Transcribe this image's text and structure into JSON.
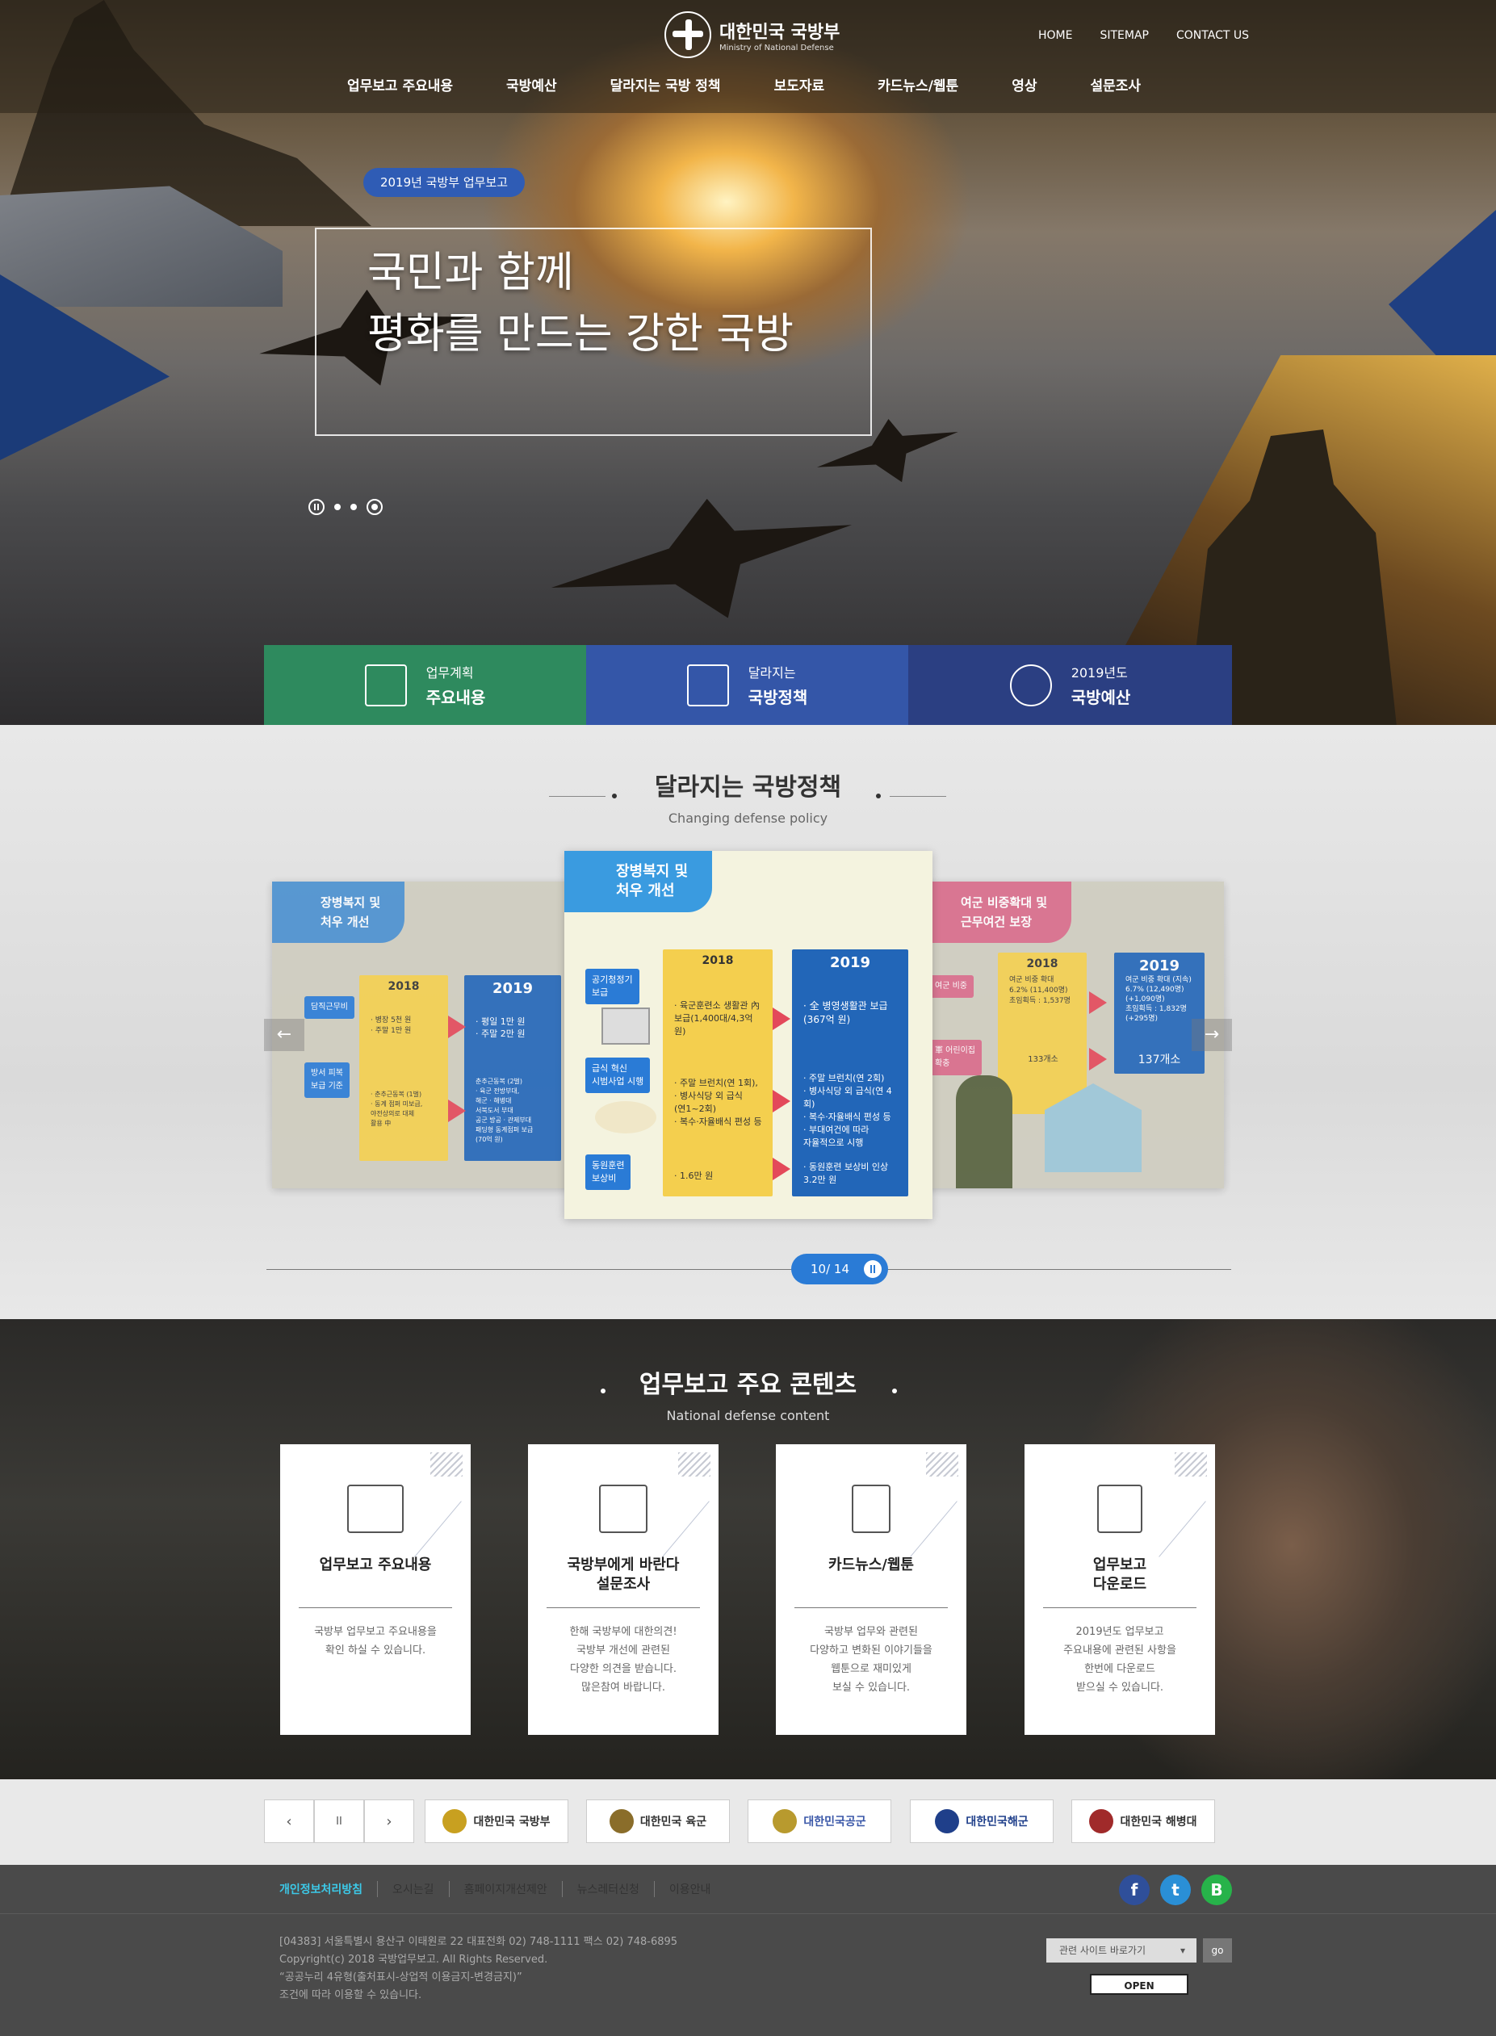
{
  "header": {
    "brand_ko": "대한민국 국방부",
    "brand_en": "Ministry of National Defense",
    "util": [
      "HOME",
      "SITEMAP",
      "CONTACT US"
    ],
    "gnb": [
      "업무보고 주요내용",
      "국방예산",
      "달라지는 국방 정책",
      "보도자료",
      "카드뉴스/웹툰",
      "영상",
      "설문조사"
    ]
  },
  "hero": {
    "badge": "2019년 국방부 업무보고",
    "line1": "국민과 함께",
    "line2": "평화를 만드는 강한 국방",
    "quick": [
      {
        "l1": "업무계획",
        "l2": "주요내용",
        "color": "#2e8a5e"
      },
      {
        "l1": "달라지는",
        "l2": "국방정책",
        "color": "#3456a8"
      },
      {
        "l1": "2019년도",
        "l2": "국방예산",
        "color": "#2b3f82"
      }
    ]
  },
  "policy": {
    "title": "달라지는 국방정책",
    "subtitle": "Changing defense policy",
    "prev": "←",
    "next": "→",
    "pager": "10/ 14",
    "left_card": {
      "title": "장병복지 및\n처우 개선",
      "y2018": "2018",
      "y2019": "2019",
      "label1": "담직근무비",
      "label2": "방서 피복\n보급 기준",
      "left1": "· 병장 5천 원\n· 주말 1만 원",
      "left2": "· 춘추근동복 (1벌)\n· 동계 점퍼 미보급,\n야전상의로 대체\n활용 中",
      "right1": "· 평일 1만 원\n· 주말 2만 원",
      "right2": "춘추근동복 (2벌)\n· 육군 전방부대,\n해군 · 해병대\n서북도서 부대\n공군 방공 · 관제부대\n패딩형 동계점퍼 보급\n(70억 원)"
    },
    "center_card": {
      "title": "장병복지 및\n처우 개선",
      "y2018": "2018",
      "y2019": "2019",
      "label1": "공기청정기\n보급",
      "label2": "급식 혁신\n시범사업 시행",
      "label3": "동원훈련\n보상비",
      "left1": "· 육군훈련소 생활관 內\n보급(1,400대/4,3억 원)",
      "left2": "· 주말 브런치(연 1회),\n· 병사식당 외 급식\n(연1~2회)\n· 복수·자율배식 편성 등",
      "left3": "· 1.6만 원",
      "right1": "· 全 병영생활관 보급\n(367억 원)",
      "right2": "· 주말 브런치(연 2회)\n· 병사식당 외 급식(연 4회)\n· 복수·자율배식 편성 등\n· 부대여건에 따라\n자율적으로 시행",
      "right3": "· 동원훈련 보상비 인상\n3.2만 원"
    },
    "right_card": {
      "title": "여군 비중확대 및\n근무여건 보장",
      "y2018": "2018",
      "y2019": "2019",
      "label1": "여군 비중",
      "label2": "軍 어린이집\n확충",
      "left1": "여군 비중 확대\n6.2% (11,400명)\n초임획득 : 1,537명",
      "left2": "133개소",
      "right1": "여군 비중 확대 (지속)\n6.7% (12,490명)\n(+1,090명)\n초임획득 : 1,832명\n(+295명)",
      "right2": "137개소"
    }
  },
  "content": {
    "title": "업무보고 주요 콘텐츠",
    "subtitle": "National defense content",
    "cards": [
      {
        "title": "업무보고 주요내용",
        "desc": "국방부 업무보고 주요내용을\n확인 하실 수 있습니다."
      },
      {
        "title": "국방부에게 바란다\n설문조사",
        "desc": "한해 국방부에 대한의견!\n국방부 개선에 관련된\n다양한 의견을 받습니다.\n많은참여 바랍니다."
      },
      {
        "title": "카드뉴스/웹툰",
        "desc": "국방부 업무와 관련된\n다양하고 변화된 이야기들을\n웹툰으로 재미있게\n보실 수 있습니다."
      },
      {
        "title": "업무보고\n다운로드",
        "desc": "2019년도 업무보고\n주요내용에 관련된 사항을\n한번에 다운로드\n받으실 수 있습니다."
      }
    ]
  },
  "banners": {
    "prev": "‹",
    "pause": "II",
    "next": "›",
    "items": [
      {
        "name": "대한민국 국방부",
        "color": "#c8a020"
      },
      {
        "name": "대한민국 육군",
        "color": "#8a6d2a"
      },
      {
        "name": "대한민국공군",
        "color": "#b89a2e"
      },
      {
        "name": "대한민국해군",
        "color": "#1f3f8a"
      },
      {
        "name": "대한민국 해병대",
        "color": "#a02a2a"
      }
    ]
  },
  "footer": {
    "links": [
      "개인정보처리방침",
      "오시는길",
      "홈페이지개선제안",
      "뉴스레터신청",
      "이용안내"
    ],
    "address": "[04383] 서울특별시 용산구 이태원로 22 대표전화 02) 748-1111 팩스 02) 748-6895",
    "copyright": "Copyright(c) 2018 국방업무보고. All Rights Reserved.",
    "license1": "“공공누리 4유형(출처표시-상업적 이용금지-변경금지)”",
    "license2": "조건에 따라 이용할 수 있습니다.",
    "related": "관련 사이트 바로가기",
    "go": "go",
    "open": "OPEN",
    "sns": [
      {
        "label": "f",
        "color": "#2f4f9a"
      },
      {
        "label": "t",
        "color": "#2a8fd6"
      },
      {
        "label": "B",
        "color": "#27b34a"
      }
    ]
  }
}
